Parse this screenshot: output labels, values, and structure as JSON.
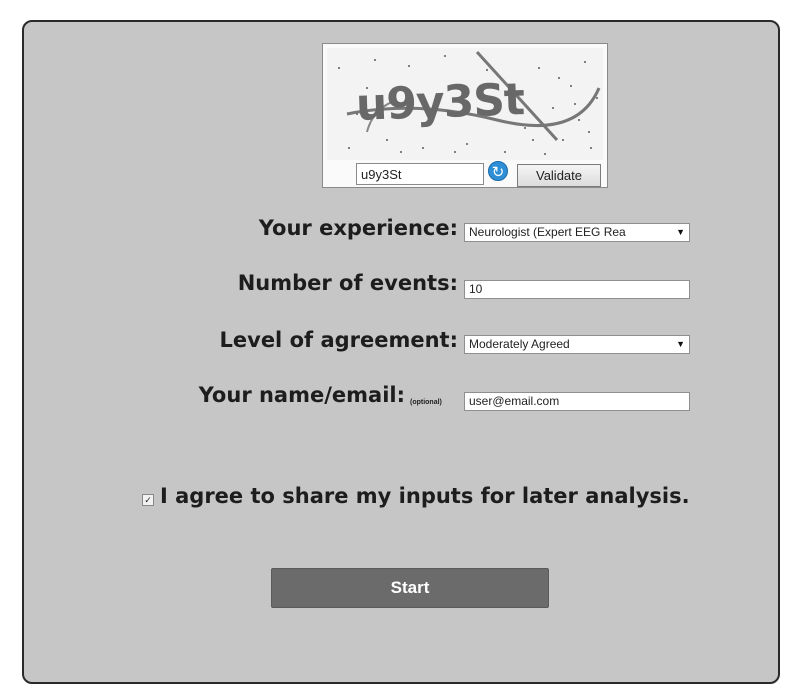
{
  "captcha": {
    "image_text": "u9y3St",
    "input_value": "u9y3St",
    "refresh_icon": "refresh-icon",
    "validate_label": "Validate"
  },
  "form": {
    "experience": {
      "label": "Your experience:",
      "value": "Neurologist (Expert EEG Rea"
    },
    "events": {
      "label": "Number of events:",
      "value": "10"
    },
    "agreement": {
      "label": "Level of agreement:",
      "value": "Moderately Agreed"
    },
    "name": {
      "label": "Your name/email:",
      "note": "(optional)",
      "value": "user@email.com"
    },
    "consent": {
      "label": "I agree to share my inputs for later analysis.",
      "checked": true
    }
  },
  "start_label": "Start",
  "colors": {
    "panel": "#c6c6c6",
    "button": "#6b6b6b",
    "accent": "#2f8fd6"
  }
}
